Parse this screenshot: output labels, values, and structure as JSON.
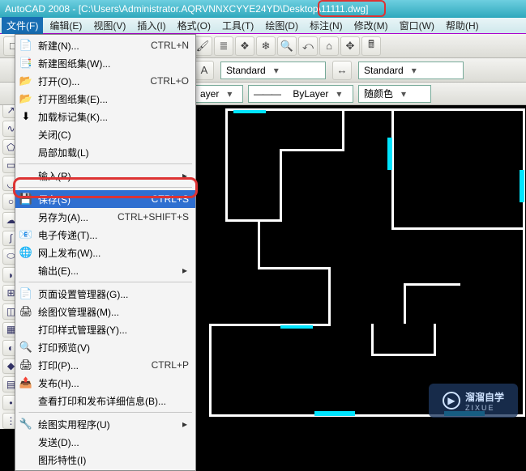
{
  "title": "AutoCAD 2008 - [C:\\Users\\Administrator.AQRVNNXCYYE24YD\\Desktop\\11111.dwg]",
  "menubar": [
    {
      "label": "文件(F)",
      "open": true
    },
    {
      "label": "编辑(E)"
    },
    {
      "label": "视图(V)"
    },
    {
      "label": "插入(I)"
    },
    {
      "label": "格式(O)"
    },
    {
      "label": "工具(T)"
    },
    {
      "label": "绘图(D)"
    },
    {
      "label": "标注(N)"
    },
    {
      "label": "修改(M)"
    },
    {
      "label": "窗口(W)"
    },
    {
      "label": "帮助(H)"
    }
  ],
  "toolbar_top_icons": [
    "file-new",
    "file-open",
    "save",
    "undo",
    "redo",
    "cut",
    "copy",
    "paste",
    "match",
    "paint",
    "layer-prev",
    "layer-mgr",
    "freeze",
    "zoom-window",
    "zoom-prev",
    "zoom-ext",
    "pan",
    "calc"
  ],
  "style_combo1": "Standard",
  "style_combo2": "Standard",
  "layer_combo": "ayer",
  "linetype_combo": "ByLayer",
  "color_combo": "随颜色",
  "vtool_icons": [
    "line",
    "xline",
    "pline",
    "polygon",
    "rect",
    "arc",
    "circle",
    "revcloud",
    "spline",
    "ellipse",
    "ellipse-arc",
    "insert",
    "block",
    "hatch",
    "gradient",
    "region",
    "table",
    "point",
    "divide"
  ],
  "file_menu": [
    {
      "icon": "📄",
      "label": "新建(N)...",
      "shortcut": "CTRL+N"
    },
    {
      "icon": "📑",
      "label": "新建图纸集(W)..."
    },
    {
      "icon": "📂",
      "label": "打开(O)...",
      "shortcut": "CTRL+O"
    },
    {
      "icon": "📂",
      "label": "打开图纸集(E)..."
    },
    {
      "icon": "⬇",
      "label": "加载标记集(K)..."
    },
    {
      "icon": "",
      "label": "关闭(C)"
    },
    {
      "icon": "",
      "label": "局部加载(L)"
    },
    {
      "sep": true
    },
    {
      "icon": "",
      "label": "输入(R)...",
      "arrow": true
    },
    {
      "sep": true
    },
    {
      "icon": "💾",
      "label": "保存(S)",
      "shortcut": "CTRL+S",
      "selected": true
    },
    {
      "icon": "",
      "label": "另存为(A)...",
      "shortcut": "CTRL+SHIFT+S"
    },
    {
      "icon": "📧",
      "label": "电子传递(T)..."
    },
    {
      "icon": "🌐",
      "label": "网上发布(W)..."
    },
    {
      "icon": "",
      "label": "输出(E)...",
      "arrow": true
    },
    {
      "sep": true
    },
    {
      "icon": "📄",
      "label": "页面设置管理器(G)..."
    },
    {
      "icon": "🖨",
      "label": "绘图仪管理器(M)..."
    },
    {
      "icon": "",
      "label": "打印样式管理器(Y)..."
    },
    {
      "icon": "🔍",
      "label": "打印预览(V)"
    },
    {
      "icon": "🖨",
      "label": "打印(P)...",
      "shortcut": "CTRL+P"
    },
    {
      "icon": "📤",
      "label": "发布(H)..."
    },
    {
      "icon": "",
      "label": "查看打印和发布详细信息(B)..."
    },
    {
      "sep": true
    },
    {
      "icon": "🔧",
      "label": "绘图实用程序(U)",
      "arrow": true
    },
    {
      "icon": "",
      "label": "发送(D)..."
    },
    {
      "icon": "",
      "label": "图形特性(I)"
    }
  ],
  "watermark": {
    "brand": "溜溜自学",
    "sub": "ZIXUE"
  }
}
